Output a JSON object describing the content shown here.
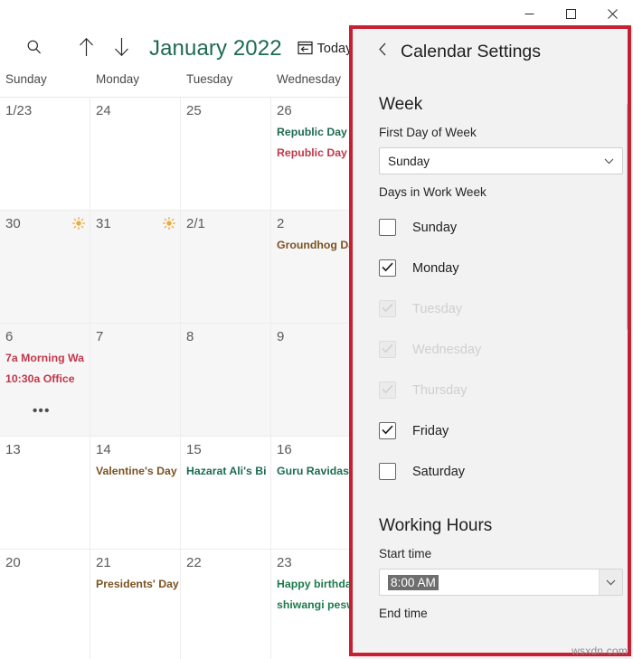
{
  "window": {
    "controls": [
      {
        "name": "minimize",
        "glyph": "minimize-icon"
      },
      {
        "name": "maximize",
        "glyph": "maximize-icon"
      },
      {
        "name": "close",
        "glyph": "close-icon"
      }
    ]
  },
  "calendar": {
    "toolbar": {
      "search_icon": "search-icon",
      "prev_icon": "arrow-up-icon",
      "next_icon": "arrow-down-icon",
      "month_title": "January 2022",
      "today_label": "Today",
      "today_icon": "calendar-today-icon"
    },
    "day_names": [
      "Sunday",
      "Monday",
      "Tuesday",
      "Wednesday"
    ],
    "rows": [
      {
        "shaded": false,
        "cells": [
          {
            "date": "1/23",
            "weather": "",
            "events": [],
            "more": false
          },
          {
            "date": "24",
            "weather": "",
            "events": [],
            "more": false
          },
          {
            "date": "25",
            "weather": "",
            "events": [],
            "more": false
          },
          {
            "date": "26",
            "weather": "",
            "events": [
              {
                "text": "Republic Day",
                "color": "#1d6b52"
              },
              {
                "text": "Republic Day",
                "color": "#c0384b"
              }
            ],
            "more": false
          }
        ]
      },
      {
        "shaded": true,
        "cells": [
          {
            "date": "30",
            "weather": "sun-icon",
            "events": [],
            "more": false
          },
          {
            "date": "31",
            "weather": "sun-icon",
            "events": [],
            "more": false
          },
          {
            "date": "2/1",
            "weather": "",
            "events": [],
            "more": false
          },
          {
            "date": "2",
            "weather": "",
            "events": [
              {
                "text": "Groundhog Day",
                "color": "#7b5223"
              }
            ],
            "more": false
          }
        ]
      },
      {
        "shaded": true,
        "cells": [
          {
            "date": "6",
            "weather": "",
            "events": [
              {
                "text": "7a Morning Wa",
                "color": "#c0384b"
              },
              {
                "text": "10:30a Office",
                "color": "#c0384b"
              }
            ],
            "more": true,
            "more_label": "•••"
          },
          {
            "date": "7",
            "weather": "",
            "events": [],
            "more": false
          },
          {
            "date": "8",
            "weather": "",
            "events": [],
            "more": false
          },
          {
            "date": "9",
            "weather": "",
            "events": [],
            "more": false
          }
        ]
      },
      {
        "shaded": false,
        "cells": [
          {
            "date": "13",
            "weather": "",
            "events": [],
            "more": false
          },
          {
            "date": "14",
            "weather": "",
            "events": [
              {
                "text": "Valentine's Day",
                "color": "#7b5223"
              }
            ],
            "more": false
          },
          {
            "date": "15",
            "weather": "",
            "events": [
              {
                "text": "Hazarat Ali's Bi",
                "color": "#1d6b52"
              }
            ],
            "more": false
          },
          {
            "date": "16",
            "weather": "",
            "events": [
              {
                "text": "Guru Ravidas Ja",
                "color": "#1d6b52"
              }
            ],
            "more": false
          }
        ]
      },
      {
        "shaded": false,
        "cells": [
          {
            "date": "20",
            "weather": "",
            "events": [],
            "more": false
          },
          {
            "date": "21",
            "weather": "",
            "events": [
              {
                "text": "Presidents' Day",
                "color": "#7b5223"
              }
            ],
            "more": false
          },
          {
            "date": "22",
            "weather": "",
            "events": [],
            "more": false
          },
          {
            "date": "23",
            "weather": "",
            "events": [
              {
                "text": "Happy birthday",
                "color": "#1d7a4c"
              },
              {
                "text": "shiwangi peswa",
                "color": "#1d7a4c"
              }
            ],
            "more": false
          }
        ]
      }
    ]
  },
  "settings": {
    "back_icon": "chevron-left-icon",
    "title": "Calendar Settings",
    "week_section": {
      "heading": "Week",
      "first_day_label": "First Day of Week",
      "first_day_value": "Sunday",
      "days_label": "Days in Work Week",
      "days": [
        {
          "label": "Sunday",
          "checked": false,
          "disabled": false
        },
        {
          "label": "Monday",
          "checked": true,
          "disabled": false
        },
        {
          "label": "Tuesday",
          "checked": true,
          "disabled": true
        },
        {
          "label": "Wednesday",
          "checked": true,
          "disabled": true
        },
        {
          "label": "Thursday",
          "checked": true,
          "disabled": true
        },
        {
          "label": "Friday",
          "checked": true,
          "disabled": false
        },
        {
          "label": "Saturday",
          "checked": false,
          "disabled": false
        }
      ]
    },
    "working_hours_section": {
      "heading": "Working Hours",
      "start_label": "Start time",
      "start_value": "8:00 AM",
      "end_label": "End time"
    }
  },
  "highlight": {
    "color": "#c62033"
  },
  "watermark": "wsxdn.com"
}
